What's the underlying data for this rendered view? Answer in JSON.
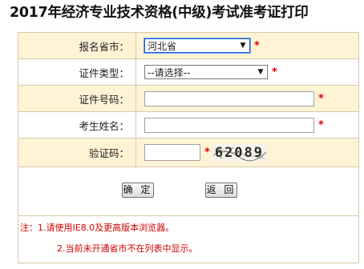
{
  "page": {
    "title": "2017年经济专业技术资格(中级)考试准考证打印"
  },
  "form": {
    "province": {
      "label": "报名省市：",
      "value": "河北省",
      "required_mark": "*"
    },
    "id_type": {
      "label": "证件类型：",
      "value": "--请选择--",
      "required_mark": "*"
    },
    "id_number": {
      "label": "证件号码：",
      "value": "",
      "required_mark": "*"
    },
    "name": {
      "label": "考生姓名：",
      "value": "",
      "required_mark": "*"
    },
    "captcha": {
      "label": "验证码：",
      "value": "",
      "required_mark": "*",
      "image_text": "62089"
    }
  },
  "buttons": {
    "confirm": "确 定",
    "back": "返 回"
  },
  "notes": {
    "line1": "注：1.请使用IE8.0及更高版本浏览器。",
    "line2": "2.当前未开通省市不在列表中显示。"
  },
  "colors": {
    "required": "#e00000",
    "alt_row_bg": "#fff3d6",
    "border": "#d8c8a8",
    "note_text": "#d00000"
  }
}
